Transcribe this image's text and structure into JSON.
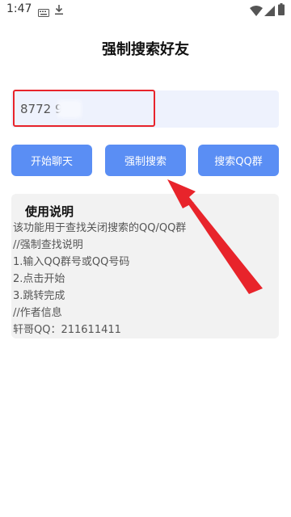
{
  "status_bar": {
    "time": "1:47",
    "icons": [
      "keyboard-icon",
      "download-icon",
      "wifi-icon",
      "signal-icon",
      "battery-icon"
    ]
  },
  "page": {
    "title": "强制搜索好友"
  },
  "search": {
    "value": "8772 95",
    "value_visible_prefix": "8772",
    "value_visible_suffix": "95"
  },
  "buttons": {
    "start_chat": "开始聊天",
    "force_search": "强制搜索",
    "search_group": "搜索QQ群"
  },
  "instructions": {
    "title": "使用说明",
    "lines": [
      "该功能用于查找关闭搜索的QQ/QQ群",
      "//强制查找说明",
      "1.输入QQ群号或QQ号码",
      "2.点击开始",
      "3.跳转完成",
      "//作者信息",
      "轩哥QQ：211611411"
    ]
  },
  "colors": {
    "button": "#5a8ef4",
    "input_bg": "#eef2fd",
    "annotation": "#e8242b",
    "panel_bg": "#f2f2f2"
  }
}
